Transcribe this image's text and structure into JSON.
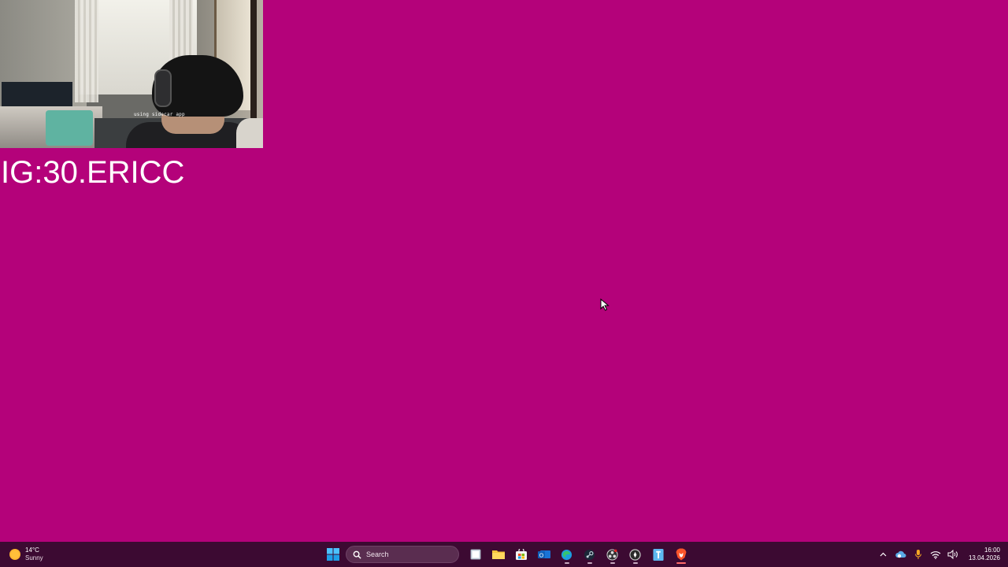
{
  "webcam": {
    "caption": "using sidecar app"
  },
  "overlay": {
    "title": "IG:30.ERICC"
  },
  "taskbar": {
    "weather": {
      "temperature": "14°C",
      "condition": "Sunny",
      "icon": "sun-icon"
    },
    "search": {
      "placeholder": "Search"
    },
    "pinned_apps": [
      {
        "name": "start-button",
        "icon": "windows-logo-icon"
      },
      {
        "name": "task-view",
        "icon": "task-view-icon"
      },
      {
        "name": "file-explorer",
        "icon": "folder-icon"
      },
      {
        "name": "microsoft-store",
        "icon": "store-icon"
      },
      {
        "name": "outlook",
        "icon": "mail-icon"
      },
      {
        "name": "edge",
        "icon": "edge-icon"
      },
      {
        "name": "steam",
        "icon": "steam-icon"
      },
      {
        "name": "obs",
        "icon": "obs-icon"
      },
      {
        "name": "app-circle",
        "icon": "circle-app-icon"
      },
      {
        "name": "app-blue",
        "icon": "blue-app-icon"
      },
      {
        "name": "brave",
        "icon": "brave-lion-icon"
      }
    ],
    "tray": {
      "time": "16:00",
      "date": "13.04.2026"
    },
    "colors": {
      "background": "#3c0a32",
      "desktop": "#b4027a"
    }
  }
}
